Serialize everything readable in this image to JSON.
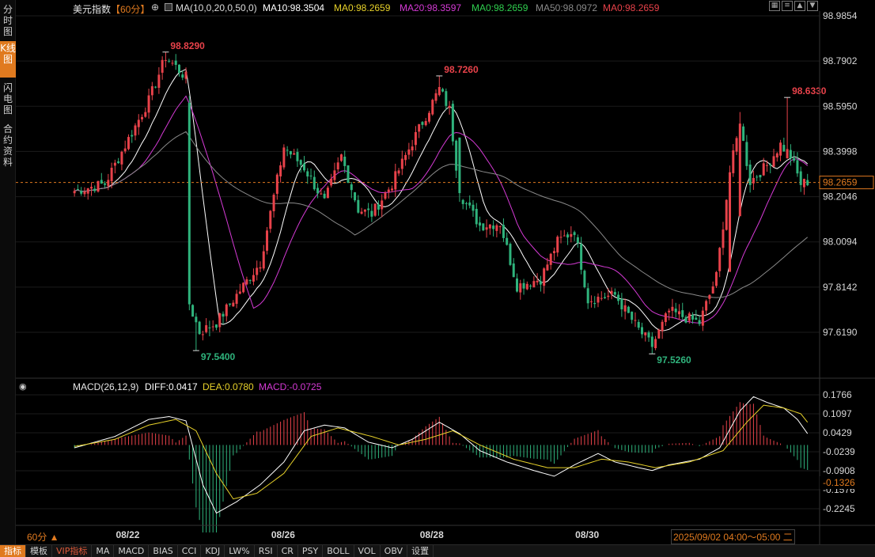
{
  "left_tabs": [
    {
      "label": "分时图",
      "active": false
    },
    {
      "label": "K线图",
      "active": true
    },
    {
      "label": "闪电图",
      "active": false
    },
    {
      "label": "合约资料",
      "active": false
    }
  ],
  "header": {
    "symbol": "美元指数",
    "period": "【60分】",
    "ma_config": "MA(10,0,20,0,50,0)",
    "ma10": "MA10:98.3504",
    "ma0_a": "MA0:98.2659",
    "ma20": "MA20:98.3597",
    "ma0_b": "MA0:98.2659",
    "ma50": "MA50:98.0972",
    "ma0_c": "MA0:98.2659"
  },
  "macd_header": {
    "label": "MACD(26,12,9)",
    "diff": "DIFF:0.0417",
    "dea": "DEA:0.0780",
    "macd": "MACD:-0.0725"
  },
  "colors": {
    "up": "#e8424a",
    "down": "#2fb37c",
    "ma10": "#ffffff",
    "ma20": "#d53ad5",
    "ma50": "#8a8a8a",
    "dea": "#e8d22a",
    "accent": "#e07a1f",
    "ma0_yellow": "#e8d22a",
    "ma0_green": "#2fcf4f",
    "ma0_red": "#e8424a"
  },
  "footer": {
    "period_label": "60分 ▲",
    "datetime": "2025/09/02 04:00～05:00 二"
  },
  "bottom_tabs": [
    {
      "label": "指标",
      "active": true,
      "vip": false
    },
    {
      "label": "模板",
      "active": false,
      "vip": false
    },
    {
      "label": "VIP指标",
      "active": false,
      "vip": true
    },
    {
      "label": "MA",
      "active": false,
      "vip": false
    },
    {
      "label": "MACD",
      "active": false,
      "vip": false
    },
    {
      "label": "BIAS",
      "active": false,
      "vip": false
    },
    {
      "label": "CCI",
      "active": false,
      "vip": false
    },
    {
      "label": "KDJ",
      "active": false,
      "vip": false
    },
    {
      "label": "LW%",
      "active": false,
      "vip": false
    },
    {
      "label": "RSI",
      "active": false,
      "vip": false
    },
    {
      "label": "CR",
      "active": false,
      "vip": false
    },
    {
      "label": "PSY",
      "active": false,
      "vip": false
    },
    {
      "label": "BOLL",
      "active": false,
      "vip": false
    },
    {
      "label": "VOL",
      "active": false,
      "vip": false
    },
    {
      "label": "OBV",
      "active": false,
      "vip": false
    },
    {
      "label": "设置",
      "active": false,
      "vip": false
    }
  ],
  "chart_data": [
    {
      "type": "candlestick",
      "y_ticks": [
        "98.9854",
        "98.7902",
        "98.5950",
        "98.3998",
        "98.2046",
        "98.0094",
        "97.8142",
        "97.6190"
      ],
      "ylim": [
        97.54,
        98.99
      ],
      "x_ticks": [
        "08/22",
        "08/26",
        "08/28",
        "08/30"
      ],
      "last_price": "98.2659",
      "annotations": [
        {
          "text": "98.8290",
          "value": 98.829,
          "bar": 27
        },
        {
          "text": "97.5400",
          "value": 97.54,
          "bar": 36
        },
        {
          "text": "98.7260",
          "value": 98.726,
          "bar": 108
        },
        {
          "text": "97.5260",
          "value": 97.526,
          "bar": 171
        },
        {
          "text": "98.6330",
          "value": 98.633,
          "bar": 211
        }
      ],
      "key_closes": [
        {
          "bar": 0,
          "close": 98.23
        },
        {
          "bar": 9,
          "close": 98.26
        },
        {
          "bar": 22,
          "close": 98.62
        },
        {
          "bar": 27,
          "close": 98.81
        },
        {
          "bar": 33,
          "close": 98.72
        },
        {
          "bar": 34,
          "close": 97.74
        },
        {
          "bar": 37,
          "close": 97.62
        },
        {
          "bar": 42,
          "close": 97.66
        },
        {
          "bar": 55,
          "close": 97.92
        },
        {
          "bar": 62,
          "close": 98.42
        },
        {
          "bar": 68,
          "close": 98.33
        },
        {
          "bar": 74,
          "close": 98.18
        },
        {
          "bar": 79,
          "close": 98.38
        },
        {
          "bar": 84,
          "close": 98.15
        },
        {
          "bar": 88,
          "close": 98.13
        },
        {
          "bar": 94,
          "close": 98.26
        },
        {
          "bar": 100,
          "close": 98.44
        },
        {
          "bar": 108,
          "close": 98.67
        },
        {
          "bar": 111,
          "close": 98.58
        },
        {
          "bar": 114,
          "close": 98.22
        },
        {
          "bar": 120,
          "close": 98.08
        },
        {
          "bar": 126,
          "close": 98.09
        },
        {
          "bar": 131,
          "close": 97.82
        },
        {
          "bar": 138,
          "close": 97.85
        },
        {
          "bar": 143,
          "close": 98.01
        },
        {
          "bar": 148,
          "close": 98.06
        },
        {
          "bar": 152,
          "close": 97.76
        },
        {
          "bar": 160,
          "close": 97.78
        },
        {
          "bar": 167,
          "close": 97.63
        },
        {
          "bar": 171,
          "close": 97.56
        },
        {
          "bar": 176,
          "close": 97.71
        },
        {
          "bar": 185,
          "close": 97.66
        },
        {
          "bar": 190,
          "close": 97.86
        },
        {
          "bar": 194,
          "close": 98.31
        },
        {
          "bar": 197,
          "close": 98.52
        },
        {
          "bar": 200,
          "close": 98.27
        },
        {
          "bar": 205,
          "close": 98.34
        },
        {
          "bar": 209,
          "close": 98.43
        },
        {
          "bar": 212,
          "close": 98.38
        },
        {
          "bar": 215,
          "close": 98.26
        },
        {
          "bar": 217,
          "close": 98.27
        }
      ]
    },
    {
      "type": "macd",
      "y_ticks": [
        "0.1766",
        "0.1097",
        "0.0429",
        "-0.0239",
        "-0.0908",
        "-0.1576",
        "-0.2245"
      ],
      "ylim": [
        -0.26,
        0.19
      ],
      "last_value": "-0.1326",
      "diff_keypoints": [
        {
          "bar": 0,
          "v": -0.01
        },
        {
          "bar": 12,
          "v": 0.03
        },
        {
          "bar": 22,
          "v": 0.09
        },
        {
          "bar": 28,
          "v": 0.1
        },
        {
          "bar": 33,
          "v": 0.085
        },
        {
          "bar": 38,
          "v": -0.14
        },
        {
          "bar": 42,
          "v": -0.24
        },
        {
          "bar": 48,
          "v": -0.2
        },
        {
          "bar": 55,
          "v": -0.14
        },
        {
          "bar": 62,
          "v": -0.06
        },
        {
          "bar": 68,
          "v": 0.05
        },
        {
          "bar": 74,
          "v": 0.07
        },
        {
          "bar": 80,
          "v": 0.06
        },
        {
          "bar": 87,
          "v": 0.01
        },
        {
          "bar": 94,
          "v": -0.01
        },
        {
          "bar": 100,
          "v": 0.02
        },
        {
          "bar": 108,
          "v": 0.08
        },
        {
          "bar": 114,
          "v": 0.04
        },
        {
          "bar": 120,
          "v": -0.02
        },
        {
          "bar": 128,
          "v": -0.06
        },
        {
          "bar": 136,
          "v": -0.09
        },
        {
          "bar": 142,
          "v": -0.11
        },
        {
          "bar": 148,
          "v": -0.07
        },
        {
          "bar": 155,
          "v": -0.03
        },
        {
          "bar": 160,
          "v": -0.06
        },
        {
          "bar": 167,
          "v": -0.08
        },
        {
          "bar": 171,
          "v": -0.09
        },
        {
          "bar": 176,
          "v": -0.07
        },
        {
          "bar": 185,
          "v": -0.05
        },
        {
          "bar": 191,
          "v": -0.01
        },
        {
          "bar": 197,
          "v": 0.12
        },
        {
          "bar": 201,
          "v": 0.17
        },
        {
          "bar": 205,
          "v": 0.15
        },
        {
          "bar": 210,
          "v": 0.13
        },
        {
          "bar": 214,
          "v": 0.09
        },
        {
          "bar": 217,
          "v": 0.04
        }
      ],
      "dea_keypoints": [
        {
          "bar": 0,
          "v": -0.005
        },
        {
          "bar": 12,
          "v": 0.02
        },
        {
          "bar": 22,
          "v": 0.07
        },
        {
          "bar": 30,
          "v": 0.09
        },
        {
          "bar": 36,
          "v": 0.05
        },
        {
          "bar": 42,
          "v": -0.1
        },
        {
          "bar": 47,
          "v": -0.19
        },
        {
          "bar": 54,
          "v": -0.17
        },
        {
          "bar": 62,
          "v": -0.1
        },
        {
          "bar": 70,
          "v": 0.03
        },
        {
          "bar": 78,
          "v": 0.06
        },
        {
          "bar": 88,
          "v": 0.03
        },
        {
          "bar": 96,
          "v": 0.0
        },
        {
          "bar": 104,
          "v": 0.02
        },
        {
          "bar": 112,
          "v": 0.05
        },
        {
          "bar": 120,
          "v": 0.0
        },
        {
          "bar": 130,
          "v": -0.05
        },
        {
          "bar": 140,
          "v": -0.08
        },
        {
          "bar": 148,
          "v": -0.08
        },
        {
          "bar": 156,
          "v": -0.05
        },
        {
          "bar": 164,
          "v": -0.06
        },
        {
          "bar": 172,
          "v": -0.08
        },
        {
          "bar": 182,
          "v": -0.06
        },
        {
          "bar": 192,
          "v": -0.02
        },
        {
          "bar": 199,
          "v": 0.08
        },
        {
          "bar": 204,
          "v": 0.14
        },
        {
          "bar": 210,
          "v": 0.13
        },
        {
          "bar": 215,
          "v": 0.11
        },
        {
          "bar": 217,
          "v": 0.08
        }
      ]
    }
  ]
}
